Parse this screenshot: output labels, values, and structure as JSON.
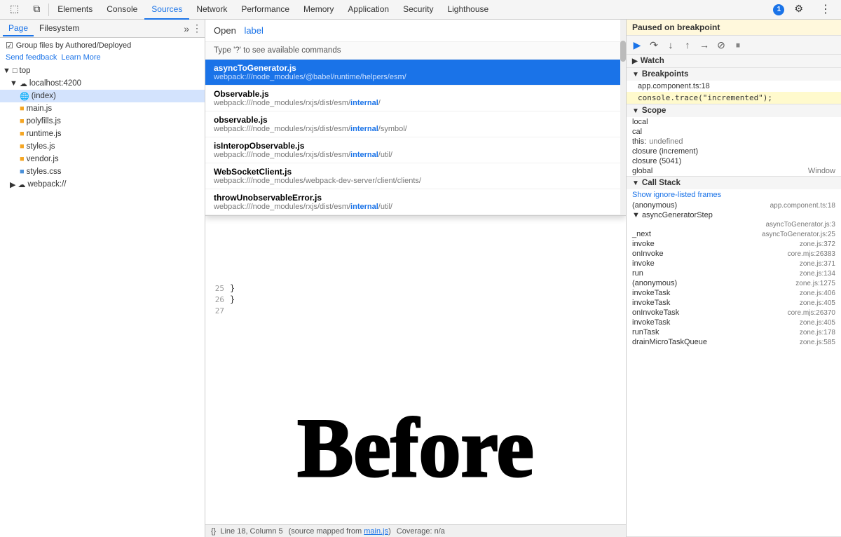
{
  "toolbar": {
    "tabs": [
      "Elements",
      "Console",
      "Sources",
      "Network",
      "Performance",
      "Memory",
      "Application",
      "Security",
      "Lighthouse"
    ],
    "active_tab": "Sources",
    "icons": {
      "inspect": "⬚",
      "device": "⧉",
      "chat_count": "1",
      "settings": "⚙",
      "more": "⋮"
    }
  },
  "left_panel": {
    "sub_tabs": [
      "Page",
      "Filesystem"
    ],
    "active_sub_tab": "Page",
    "group_files_label": "Group files by Authored/Deployed",
    "send_feedback": "Send feedback",
    "learn_more": "Learn More",
    "tree": [
      {
        "id": "top",
        "label": "top",
        "indent": 0,
        "type": "root",
        "expanded": true
      },
      {
        "id": "localhost",
        "label": "localhost:4200",
        "indent": 1,
        "type": "domain",
        "expanded": true
      },
      {
        "id": "index",
        "label": "(index)",
        "indent": 2,
        "type": "file",
        "selected": true
      },
      {
        "id": "main",
        "label": "main.js",
        "indent": 2,
        "type": "js"
      },
      {
        "id": "polyfills",
        "label": "polyfills.js",
        "indent": 2,
        "type": "js"
      },
      {
        "id": "runtime",
        "label": "runtime.js",
        "indent": 2,
        "type": "js"
      },
      {
        "id": "styles",
        "label": "styles.js",
        "indent": 2,
        "type": "js"
      },
      {
        "id": "vendor",
        "label": "vendor.js",
        "indent": 2,
        "type": "js"
      },
      {
        "id": "styles_css",
        "label": "styles.css",
        "indent": 2,
        "type": "css"
      },
      {
        "id": "webpack",
        "label": "webpack://",
        "indent": 1,
        "type": "domain"
      }
    ]
  },
  "open_dialog": {
    "open_label": "Open",
    "input_value": "label",
    "hint": "Type '?' to see available commands",
    "results": [
      {
        "id": "r1",
        "name": "asyncToGenerator.js",
        "path": "webpack:///node_modules/@babel/runtime/helpers/esm/",
        "selected": true,
        "highlight": null
      },
      {
        "id": "r2",
        "name": "Observable.js",
        "path": "webpack:///node_modules/rxjs/dist/esm/internal/",
        "selected": false,
        "highlight": "internal"
      },
      {
        "id": "r3",
        "name": "observable.js",
        "path": "webpack:///node_modules/rxjs/dist/esm/internal/symbol/",
        "selected": false,
        "highlight": "internal"
      },
      {
        "id": "r4",
        "name": "isInteropObservable.js",
        "path": "webpack:///node_modules/rxjs/dist/esm/internal/util/",
        "selected": false,
        "highlight": "internal"
      },
      {
        "id": "r5",
        "name": "WebSocketClient.js",
        "path": "webpack:///node_modules/webpack-dev-server/client/clients/",
        "selected": false,
        "highlight": null
      },
      {
        "id": "r6",
        "name": "throwUnobservableError.js",
        "path": "webpack:///node_modules/rxjs/dist/esm/internal/util/",
        "selected": false,
        "highlight": "internal"
      }
    ]
  },
  "code": {
    "lines": [
      {
        "num": "25",
        "content": "  }"
      },
      {
        "num": "26",
        "content": "}"
      },
      {
        "num": "27",
        "content": ""
      }
    ],
    "before_text": "Before"
  },
  "status_bar": {
    "brackets_label": "{}",
    "position": "Line 18, Column 5",
    "source_mapped": "(source mapped from main.js)",
    "coverage": "Coverage: n/a"
  },
  "right_panel": {
    "paused_header": "Paused on breakpoint",
    "debug_controls": [
      "resume",
      "step_over",
      "step_into",
      "step_out",
      "step",
      "deactivate",
      "pause"
    ],
    "watch_label": "Watch",
    "breakpoints_label": "Breakpoints",
    "breakpoint_file": "app.component.ts:18",
    "breakpoint_code": "console.trace(\"incremented\");",
    "scope_label": "Scope",
    "scope_items": [
      {
        "label": "local",
        "arrow": false
      },
      {
        "label": "cal",
        "arrow": false
      },
      {
        "label": "this: undefined",
        "arrow": false
      },
      {
        "label": "closure (increment)",
        "arrow": false
      },
      {
        "label": "closure (5041)",
        "arrow": false
      },
      {
        "label": "global",
        "value": "Window",
        "arrow": false
      }
    ],
    "call_stack_label": "Call Stack",
    "show_ignored": "Show ignore-listed frames",
    "call_stack_items": [
      {
        "fn": "(anonymous)",
        "loc": "app.component.ts:18",
        "ignored": false
      },
      {
        "fn": "▼ asyncGeneratorStep",
        "loc": "",
        "ignored": false
      },
      {
        "fn": "",
        "loc": "asyncToGenerator.js:3",
        "ignored": false
      },
      {
        "fn": "_next",
        "loc": "asyncToGenerator.js:25",
        "ignored": false
      },
      {
        "fn": "invoke",
        "loc": "zone.js:372",
        "ignored": false
      },
      {
        "fn": "onInvoke",
        "loc": "core.mjs:26383",
        "ignored": false
      },
      {
        "fn": "invoke",
        "loc": "zone.js:371",
        "ignored": false
      },
      {
        "fn": "run",
        "loc": "zone.js:134",
        "ignored": false
      },
      {
        "fn": "(anonymous)",
        "loc": "zone.js:1275",
        "ignored": false
      },
      {
        "fn": "invokeTask",
        "loc": "zone.js:406",
        "ignored": false
      },
      {
        "fn": "invokeTask",
        "loc": "zone.js:405",
        "ignored": false
      },
      {
        "fn": "onInvokeTask",
        "loc": "core.mjs:26370",
        "ignored": false
      },
      {
        "fn": "invokeTask",
        "loc": "zone.js:405",
        "ignored": false
      },
      {
        "fn": "runTask",
        "loc": "zone.js:178",
        "ignored": false
      },
      {
        "fn": "drainMicroTaskQueue",
        "loc": "zone.js:585",
        "ignored": false
      }
    ]
  }
}
